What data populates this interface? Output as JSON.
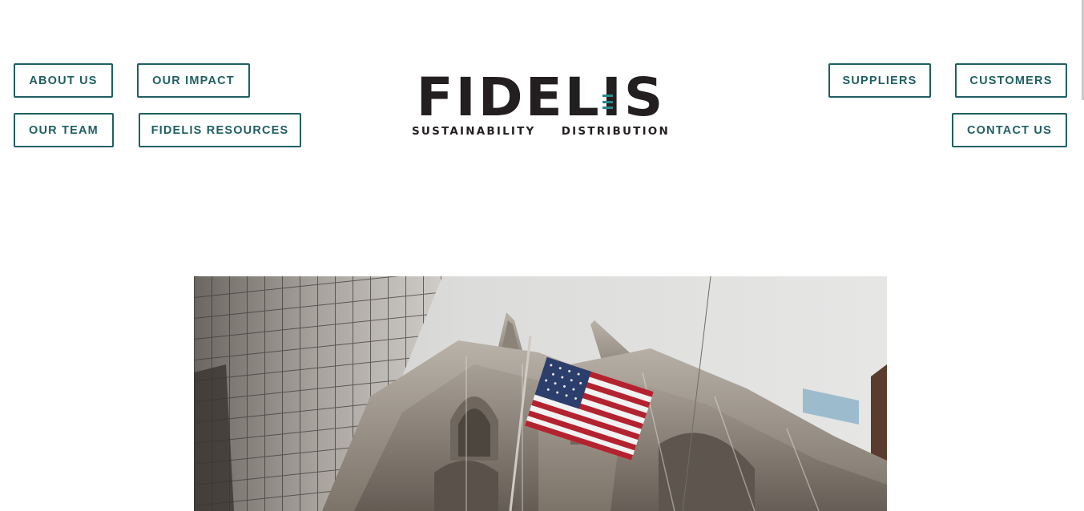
{
  "nav": {
    "left_top": [
      "ABOUT US",
      "OUR IMPACT"
    ],
    "left_bottom": [
      "OUR TEAM",
      "FIDELIS RESOURCES"
    ],
    "right_top": [
      "SUPPLIERS",
      "CUSTOMERS"
    ],
    "right_bottom": [
      "CONTACT US"
    ]
  },
  "logo": {
    "wordmark": "FIDELIS",
    "tagline_left": "SUSTAINABILITY",
    "tagline_right": "DISTRIBUTION",
    "accent_color": "#2b8a8a",
    "text_color": "#231f20"
  },
  "colors": {
    "button_border": "#1f5f63",
    "button_text": "#1f5f63",
    "background": "#ffffff"
  },
  "hero": {
    "subject": "cathedral-facade-with-american-flag"
  }
}
